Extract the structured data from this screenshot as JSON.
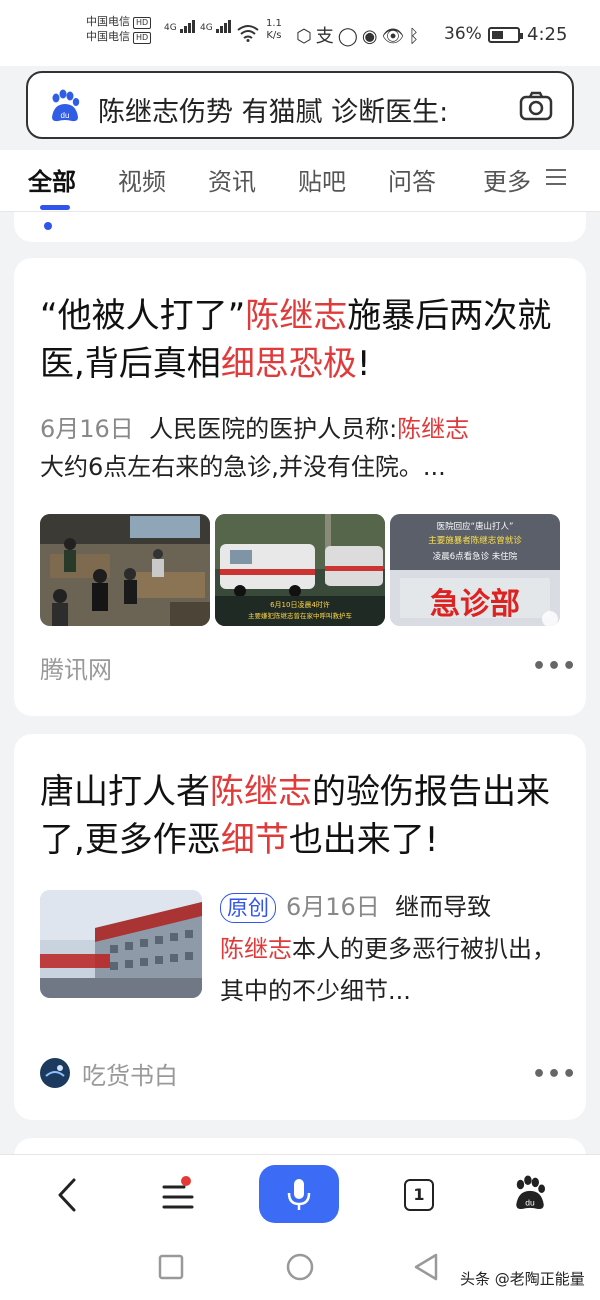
{
  "status_bar": {
    "carrier1": "中国电信",
    "carrier2": "中国电信",
    "hd": "HD",
    "net1": "4G",
    "net2": "4G",
    "speed_value": "1.1",
    "speed_unit": "K/s",
    "battery": "36%",
    "time": "4:25"
  },
  "search": {
    "query": "陈继志伤势 有猫腻 诊断医生:"
  },
  "tabs": [
    {
      "label": "全部"
    },
    {
      "label": "视频"
    },
    {
      "label": "资讯"
    },
    {
      "label": "贴吧"
    },
    {
      "label": "问答"
    },
    {
      "label": "更多"
    }
  ],
  "results": [
    {
      "title_part1": "“他被人打了”",
      "title_hl1": "陈继志",
      "title_part2": "施暴后两次就医,背后真相",
      "title_hl2": "细思恐极",
      "title_part3": "!",
      "date": "6月16日",
      "snippet_part1": "人民医院的医护人员称:",
      "snippet_hl": "陈继志",
      "snippet_part2": "大约6点左右来的急诊,并没有住院。...",
      "thumb2_caption1": "6月10日凌晨4时许",
      "thumb2_caption2": "主要嫌犯陈继志曾在家中呼叫救护车",
      "thumb3_caption1": "医院回应“唐山打人”",
      "thumb3_caption2": "主要施暴者陈继志曾就诊",
      "thumb3_caption3": "凌晨6点看急诊 未住院",
      "thumb3_sign": "急诊部",
      "source": "腾讯网"
    },
    {
      "title_part1": "唐山打人者",
      "title_hl1": "陈继志",
      "title_part2": "的验伤报告出来了,更多作恶",
      "title_hl2": "细节",
      "title_part3": "也出来了!",
      "tag": "原创",
      "date": "6月16日",
      "snippet_part1": "继而导致",
      "snippet_hl": "陈继志",
      "snippet_part2": "本人的更多恶行被扒出，其中的不少细节...",
      "source": "吃货书白"
    }
  ],
  "bottom_nav": {
    "tab_count": "1"
  },
  "watermark": "头条 @老陶正能量",
  "colors": {
    "accent": "#3154ec",
    "highlight": "#e03a3a",
    "mic": "#3c6cf5"
  }
}
